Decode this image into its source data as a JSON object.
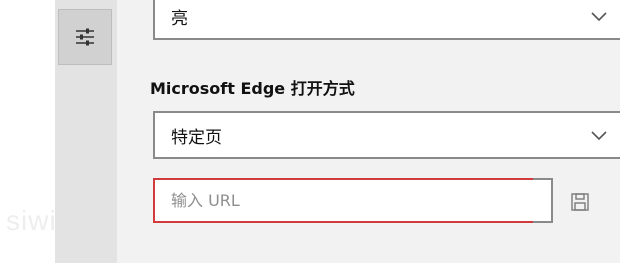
{
  "theme": {
    "selected": "亮"
  },
  "new_tab": {
    "label": "Microsoft Edge 打开方式",
    "selected": "特定页",
    "url_placeholder": "输入 URL",
    "url_value": ""
  },
  "watermark": "siwip",
  "icons": {
    "nav": "sliders-icon",
    "chevron": "chevron-down-icon",
    "save": "save-icon"
  },
  "colors": {
    "highlight_border": "#d23b3b",
    "nav_active_bg": "#d1d1d1"
  }
}
